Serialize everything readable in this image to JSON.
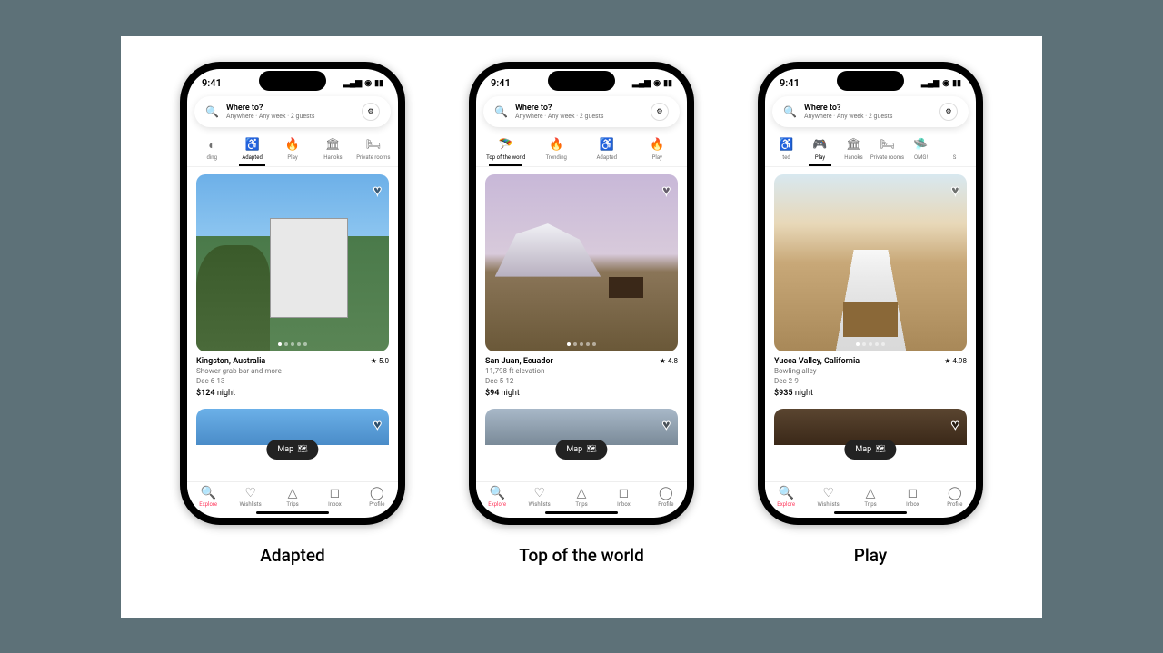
{
  "status": {
    "time": "9:41"
  },
  "search": {
    "title": "Where to?",
    "subtitle": "Anywhere · Any week · 2 guests"
  },
  "map_button": "Map",
  "tabs": {
    "explore": "Explore",
    "wishlists": "Wishlists",
    "trips": "Trips",
    "inbox": "Inbox",
    "profile": "Profile"
  },
  "screens": [
    {
      "caption": "Adapted",
      "categories": [
        {
          "label": "ding",
          "icon": "◐"
        },
        {
          "label": "Adapted",
          "icon": "♿",
          "active": true
        },
        {
          "label": "Play",
          "icon": "🔥"
        },
        {
          "label": "Hanoks",
          "icon": "🏛"
        },
        {
          "label": "Private rooms",
          "icon": "🛏"
        }
      ],
      "listing": {
        "title": "Kingston, Australia",
        "rating": "★ 5.0",
        "subtitle": "Shower grab bar and more",
        "dates": "Dec 6-13",
        "price": "$124",
        "price_unit": "night"
      }
    },
    {
      "caption": "Top of the world",
      "categories": [
        {
          "label": "Top of the world",
          "icon": "🪂",
          "active": true
        },
        {
          "label": "Trending",
          "icon": "🔥"
        },
        {
          "label": "Adapted",
          "icon": "♿"
        },
        {
          "label": "Play",
          "icon": "🔥"
        }
      ],
      "listing": {
        "title": "San Juan, Ecuador",
        "rating": "★ 4.8",
        "subtitle": "11,798 ft elevation",
        "dates": "Dec 5-12",
        "price": "$94",
        "price_unit": "night"
      }
    },
    {
      "caption": "Play",
      "categories": [
        {
          "label": "ted",
          "icon": "♿"
        },
        {
          "label": "Play",
          "icon": "🎮",
          "active": true
        },
        {
          "label": "Hanoks",
          "icon": "🏛"
        },
        {
          "label": "Private rooms",
          "icon": "🛏"
        },
        {
          "label": "OMG!",
          "icon": "🛸"
        },
        {
          "label": "S",
          "icon": ""
        }
      ],
      "listing": {
        "title": "Yucca Valley, California",
        "rating": "★ 4.98",
        "subtitle": "Bowling alley",
        "dates": "Dec 2-9",
        "price": "$935",
        "price_unit": "night"
      }
    }
  ]
}
